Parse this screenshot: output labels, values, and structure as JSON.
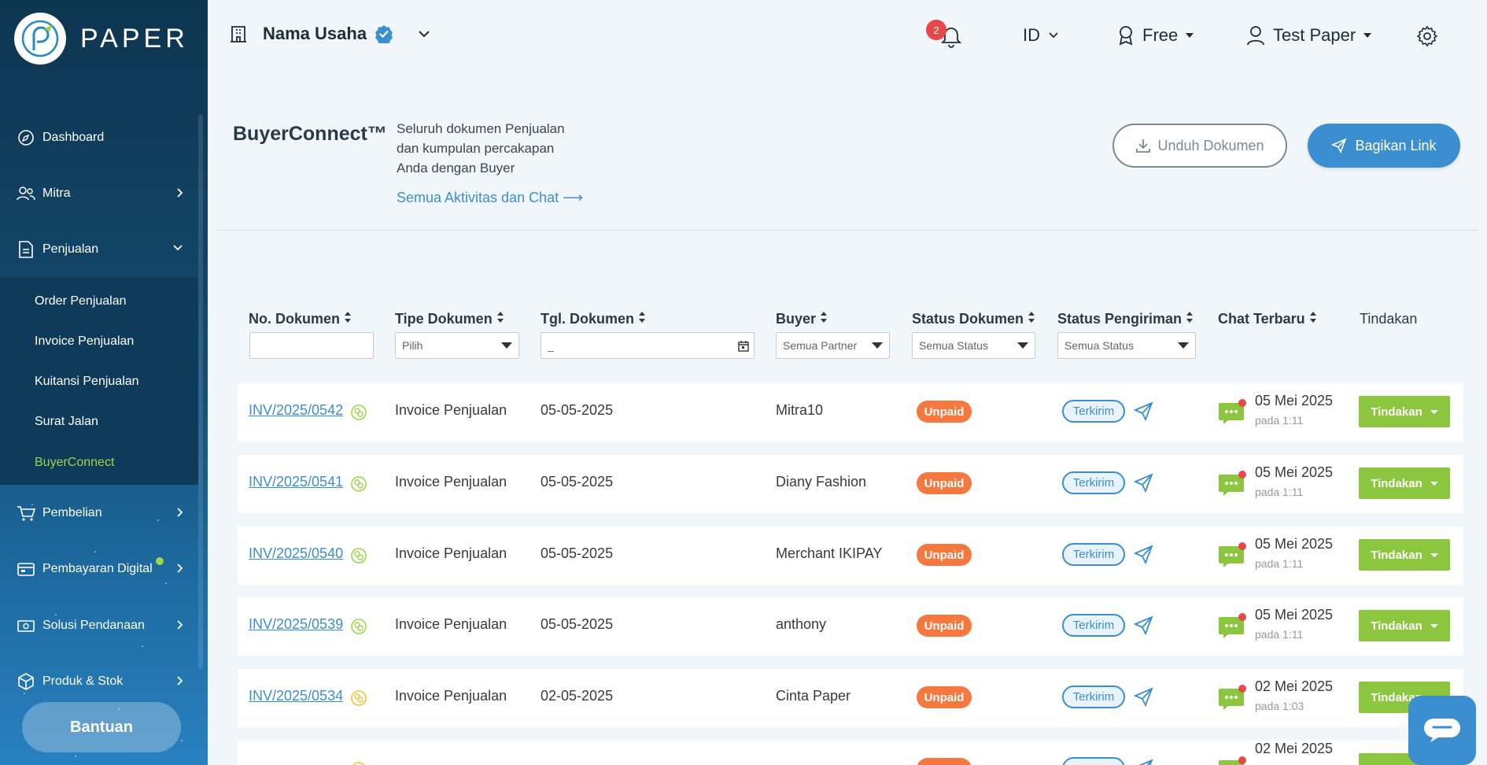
{
  "app": {
    "logo_text": "PAPER"
  },
  "sidebar": {
    "items": [
      {
        "label": "Dashboard",
        "icon": "compass-icon"
      },
      {
        "label": "Mitra",
        "icon": "users-icon"
      },
      {
        "label": "Penjualan",
        "icon": "document-icon"
      },
      {
        "label": "Pembelian",
        "icon": "cart-icon"
      },
      {
        "label": "Pembayaran Digital",
        "icon": "wallet-icon"
      },
      {
        "label": "Solusi Pendanaan",
        "icon": "cash-icon"
      },
      {
        "label": "Produk & Stok",
        "icon": "box-icon"
      }
    ],
    "submenu": [
      "Order Penjualan",
      "Invoice Penjualan",
      "Kuitansi Penjualan",
      "Surat Jalan",
      "BuyerConnect"
    ],
    "help_label": "Bantuan"
  },
  "header": {
    "business_name": "Nama Usaha",
    "notification_count": "2",
    "language": "ID",
    "plan": "Free",
    "user": "Test Paper"
  },
  "page": {
    "title": "BuyerConnect™",
    "description": "Seluruh dokumen Penjualan dan kumpulan percakapan Anda dengan Buyer",
    "activity_link": "Semua Aktivitas dan Chat",
    "download_label": "Unduh Dokumen",
    "share_label": "Bagikan Link"
  },
  "table": {
    "columns": [
      "No. Dokumen",
      "Tipe Dokumen",
      "Tgl. Dokumen",
      "Buyer",
      "Status Dokumen",
      "Status Pengiriman",
      "Chat Terbaru",
      "Tindakan"
    ],
    "filters": {
      "doc_no": "",
      "doc_type": "Pilih",
      "date": "_",
      "buyer": "Semua Partner",
      "doc_status": "Semua Status",
      "ship_status": "Semua Status"
    },
    "rows": [
      {
        "doc_no": "INV/2025/0542",
        "type": "Invoice Penjualan",
        "date": "05-05-2025",
        "buyer": "Mitra10",
        "status": "Unpaid",
        "shipping": "Terkirim",
        "chat_date": "05 Mei 2025",
        "chat_time": "pada 1:11",
        "action": "Tindakan",
        "doc_icon": "green"
      },
      {
        "doc_no": "INV/2025/0541",
        "type": "Invoice Penjualan",
        "date": "05-05-2025",
        "buyer": "Diany Fashion",
        "status": "Unpaid",
        "shipping": "Terkirim",
        "chat_date": "05 Mei 2025",
        "chat_time": "pada 1:11",
        "action": "Tindakan",
        "doc_icon": "green"
      },
      {
        "doc_no": "INV/2025/0540",
        "type": "Invoice Penjualan",
        "date": "05-05-2025",
        "buyer": "Merchant IKIPAY",
        "status": "Unpaid",
        "shipping": "Terkirim",
        "chat_date": "05 Mei 2025",
        "chat_time": "pada 1:11",
        "action": "Tindakan",
        "doc_icon": "green"
      },
      {
        "doc_no": "INV/2025/0539",
        "type": "Invoice Penjualan",
        "date": "05-05-2025",
        "buyer": "anthony",
        "status": "Unpaid",
        "shipping": "Terkirim",
        "chat_date": "05 Mei 2025",
        "chat_time": "pada 1:11",
        "action": "Tindakan",
        "doc_icon": "green"
      },
      {
        "doc_no": "INV/2025/0534",
        "type": "Invoice Penjualan",
        "date": "02-05-2025",
        "buyer": "Cinta Paper",
        "status": "Unpaid",
        "shipping": "Terkirim",
        "chat_date": "02 Mei 2025",
        "chat_time": "pada 1:03",
        "action": "Tindakan",
        "doc_icon": "yellow"
      },
      {
        "doc_no": "",
        "type": "",
        "date": "",
        "buyer": "",
        "status": "",
        "shipping": "",
        "chat_date": "02 Mei 2025",
        "chat_time": "",
        "action": "",
        "doc_icon": "yellow"
      }
    ]
  },
  "colors": {
    "primary": "#3b8fd0",
    "accent_green": "#8cc63f",
    "unpaid": "#f5783e",
    "sidebar_dark": "#0e3550"
  }
}
